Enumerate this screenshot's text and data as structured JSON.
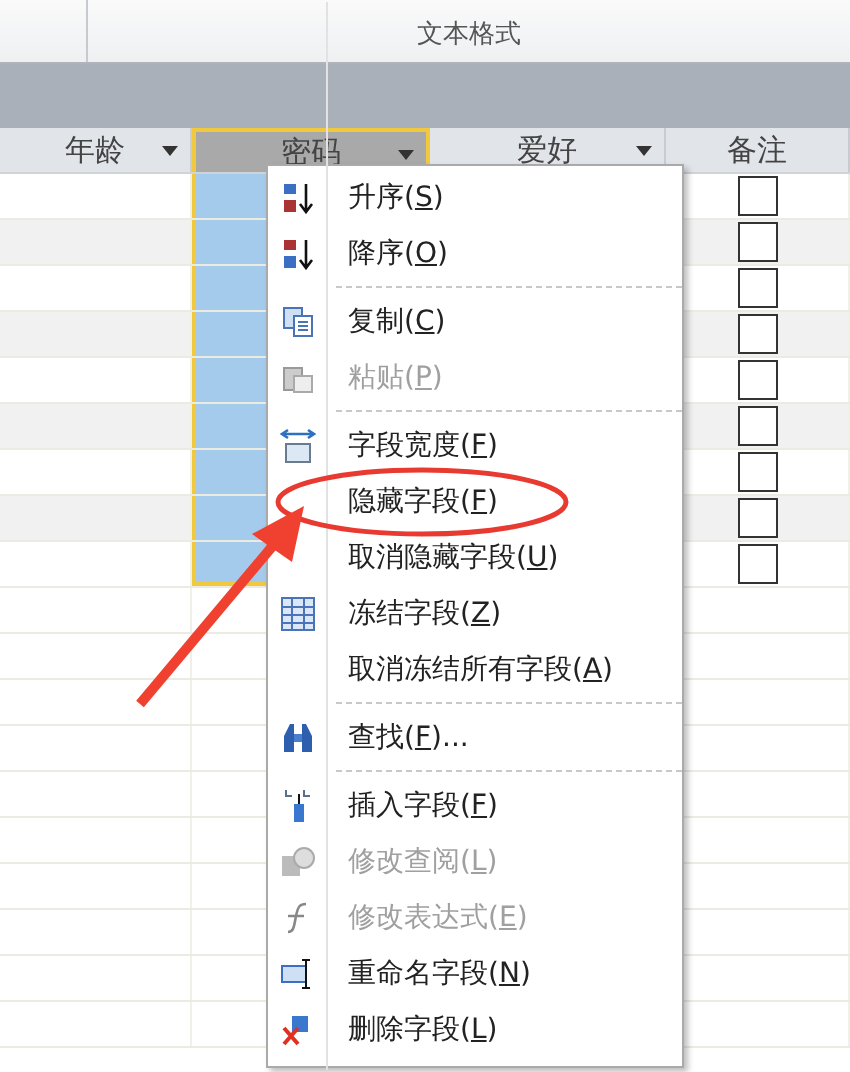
{
  "ribbon": {
    "group_label": "文本格式"
  },
  "table": {
    "columns": [
      {
        "name": "年龄",
        "selected": false,
        "filter_button": true
      },
      {
        "name": "密码",
        "selected": true,
        "filter_button": true
      },
      {
        "name": "爱好",
        "selected": false,
        "filter_button": true
      },
      {
        "name": "备注",
        "selected": false,
        "filter_button": false
      }
    ],
    "rows": [
      {
        "checked": false
      },
      {
        "checked": false
      },
      {
        "checked": false
      },
      {
        "checked": false
      },
      {
        "checked": false
      },
      {
        "checked": false
      },
      {
        "checked": false
      },
      {
        "checked": false
      },
      {
        "checked": false
      }
    ]
  },
  "context_menu": {
    "groups": [
      [
        {
          "before": "升序(",
          "accel": "S",
          "after": ")",
          "disabled": false,
          "circled": false
        },
        {
          "before": "降序(",
          "accel": "O",
          "after": ")",
          "disabled": false,
          "circled": false
        }
      ],
      [
        {
          "before": "复制(",
          "accel": "C",
          "after": ")",
          "disabled": false,
          "circled": false
        },
        {
          "before": "粘贴(",
          "accel": "P",
          "after": ")",
          "disabled": true,
          "circled": false
        }
      ],
      [
        {
          "before": "字段宽度(",
          "accel": "F",
          "after": ")",
          "disabled": false,
          "circled": false
        },
        {
          "before": "隐藏字段(",
          "accel": "F",
          "after": ")",
          "disabled": false,
          "circled": true
        },
        {
          "before": "取消隐藏字段(",
          "accel": "U",
          "after": ")",
          "disabled": false,
          "circled": false
        },
        {
          "before": "冻结字段(",
          "accel": "Z",
          "after": ")",
          "disabled": false,
          "circled": false
        },
        {
          "before": "取消冻结所有字段(",
          "accel": "A",
          "after": ")",
          "disabled": false,
          "circled": false
        }
      ],
      [
        {
          "before": "查找(",
          "accel": "F",
          "after": ")...",
          "disabled": false,
          "circled": false
        }
      ],
      [
        {
          "before": "插入字段(",
          "accel": "F",
          "after": ")",
          "disabled": false,
          "circled": false
        },
        {
          "before": "修改查阅(",
          "accel": "L",
          "after": ")",
          "disabled": true,
          "circled": false
        },
        {
          "before": "修改表达式(",
          "accel": "E",
          "after": ")",
          "disabled": true,
          "circled": false
        },
        {
          "before": "重命名字段(",
          "accel": "N",
          "after": ")",
          "disabled": false,
          "circled": false
        },
        {
          "before": "删除字段(",
          "accel": "L",
          "after": ")",
          "disabled": false,
          "circled": false
        }
      ]
    ]
  }
}
